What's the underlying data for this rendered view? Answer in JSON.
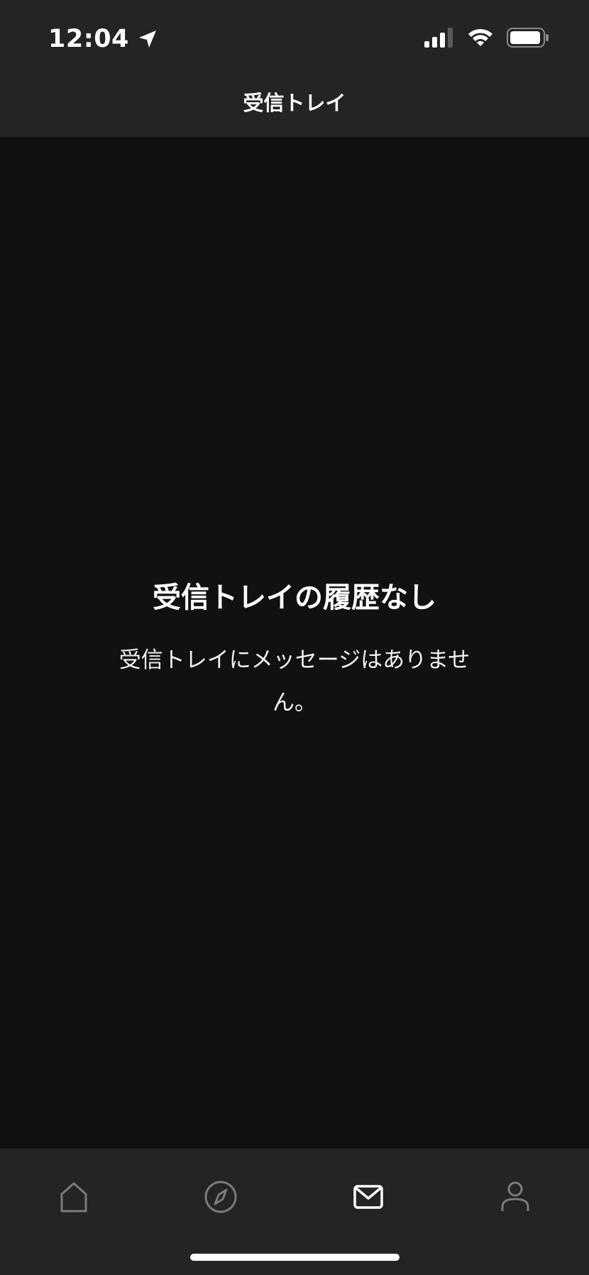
{
  "status_bar": {
    "time": "12:04",
    "location_icon": "location-arrow-icon",
    "signal_icon": "cellular-signal-icon",
    "wifi_icon": "wifi-icon",
    "battery_icon": "battery-icon"
  },
  "header": {
    "title": "受信トレイ"
  },
  "empty_state": {
    "title": "受信トレイの履歴なし",
    "description": "受信トレイにメッセージはありません。"
  },
  "tab_bar": {
    "tabs": [
      {
        "icon": "home-icon",
        "active": false
      },
      {
        "icon": "compass-icon",
        "active": false
      },
      {
        "icon": "mail-icon",
        "active": true
      },
      {
        "icon": "profile-icon",
        "active": false
      }
    ]
  },
  "colors": {
    "background": "#111111",
    "bar_background": "#242424",
    "active_icon": "#ffffff",
    "inactive_icon": "#7a7a7a"
  }
}
